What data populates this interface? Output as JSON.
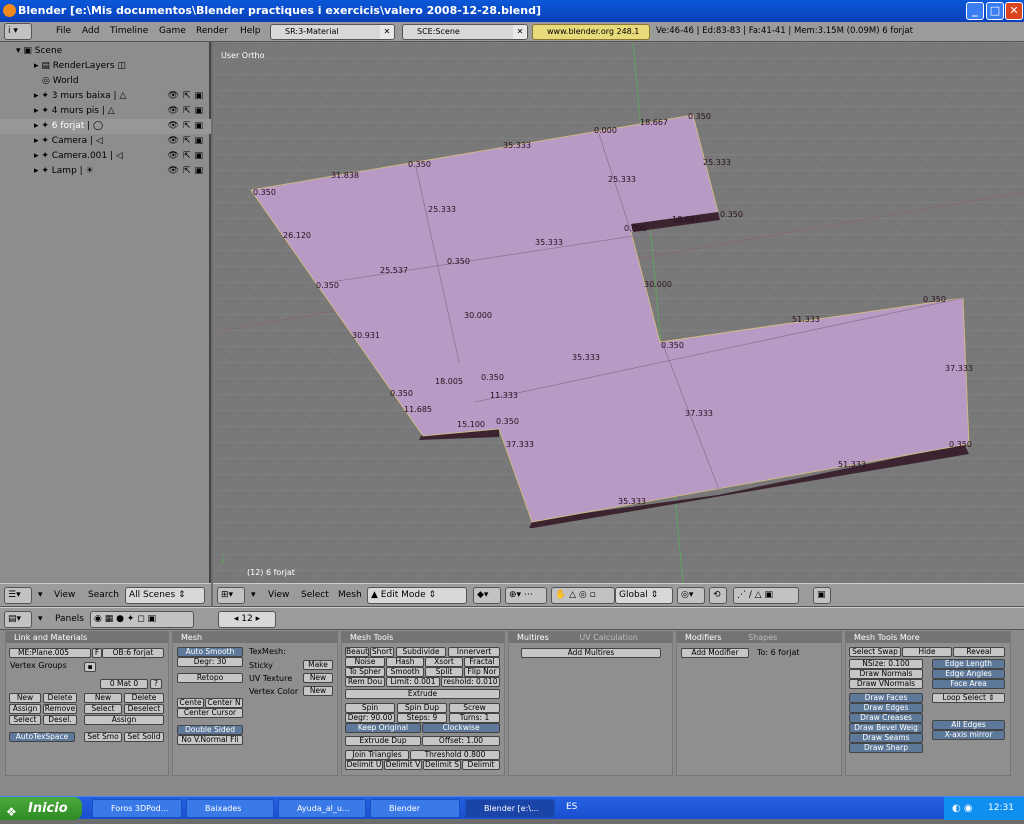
{
  "window": {
    "title": "Blender [e:\\Mis documentos\\Blender practiques i exercicis\\valero 2008-12-28.blend]"
  },
  "topbar": {
    "menus": [
      "File",
      "Add",
      "Timeline",
      "Game",
      "Render",
      "Help"
    ],
    "screen": "SR:3-Material",
    "scene": "SCE:Scene",
    "url": "www.blender.org 248.1",
    "stats": "Ve:46-46 | Ed:83-83 | Fa:41-41 | Mem:3.15M (0.09M) 6 forjat"
  },
  "outliner": {
    "items": [
      {
        "label": "Scene"
      },
      {
        "label": "RenderLayers"
      },
      {
        "label": "World"
      },
      {
        "label": "3 murs baixa"
      },
      {
        "label": "4 murs pis"
      },
      {
        "label": "6 forjat"
      },
      {
        "label": "Camera"
      },
      {
        "label": "Camera.001"
      },
      {
        "label": "Lamp"
      }
    ],
    "header": {
      "view": "View",
      "search": "Search",
      "filter": "All Scenes"
    }
  },
  "viewport": {
    "view_label": "User Ortho",
    "object_label": "(12) 6 forjat",
    "face_color": "#b79bc4",
    "dimensions": [
      {
        "text": "0.350"
      },
      {
        "text": "31.838"
      },
      {
        "text": "0.350"
      },
      {
        "text": "35.333"
      },
      {
        "text": "0.000"
      },
      {
        "text": "18.667"
      },
      {
        "text": "0.350"
      },
      {
        "text": "25.333"
      },
      {
        "text": "25.333"
      },
      {
        "text": "25.333"
      },
      {
        "text": "18.667"
      },
      {
        "text": "0.350"
      },
      {
        "text": "0.000"
      },
      {
        "text": "26.120"
      },
      {
        "text": "35.333"
      },
      {
        "text": "0.350"
      },
      {
        "text": "25.537"
      },
      {
        "text": "0.350"
      },
      {
        "text": "30.000"
      },
      {
        "text": "30.000"
      },
      {
        "text": "0.350"
      },
      {
        "text": "51.333"
      },
      {
        "text": "30.931"
      },
      {
        "text": "0.350"
      },
      {
        "text": "35.333"
      },
      {
        "text": "37.333"
      },
      {
        "text": "18.005"
      },
      {
        "text": "0.350"
      },
      {
        "text": "0.350"
      },
      {
        "text": "11.333"
      },
      {
        "text": "11.685"
      },
      {
        "text": "37.333"
      },
      {
        "text": "15.100"
      },
      {
        "text": "0.350"
      },
      {
        "text": "37.333"
      },
      {
        "text": "0.350"
      },
      {
        "text": "51.333"
      },
      {
        "text": "35.333"
      }
    ]
  },
  "viewheader": {
    "menus": [
      "View",
      "Select",
      "Mesh"
    ],
    "mode": "Edit Mode",
    "orientation": "Global"
  },
  "buttonsheader": {
    "panels": "Panels",
    "frame": "12"
  },
  "panels": {
    "link": {
      "title": "Link and Materials",
      "mesh_name": "ME:Plane.005",
      "f": "F",
      "ob_name": "OB:6 forjat",
      "vertex_groups": "Vertex Groups",
      "mat": "0 Mat 0",
      "q": "?",
      "new1": "New",
      "delete1": "Delete",
      "assign1": "Assign",
      "remove1": "Remove",
      "select1": "Select",
      "desel1": "Desel.",
      "new2": "New",
      "delete2": "Delete",
      "select2": "Select",
      "deselect2": "Deselect",
      "assign2": "Assign",
      "autotex": "AutoTexSpace",
      "setsmo": "Set Smo",
      "setsolid": "Set Solid"
    },
    "mesh": {
      "title": "Mesh",
      "autosmooth": "Auto Smooth",
      "degr": "Degr: 30",
      "retopo": "Retopo",
      "texmesh": "TexMesh:",
      "sticky": "Sticky",
      "make": "Make",
      "uvtex": "UV Texture",
      "new_uv": "New",
      "vcolor": "Vertex Color",
      "new_vc": "New",
      "centre": "Cente",
      "centren": "Center N",
      "centercursor": "Center Cursor",
      "doublesided": "Double Sided",
      "novnormal": "No V.Normal Fli"
    },
    "meshtools": {
      "title": "Mesh Tools",
      "row1": [
        "Beaut",
        "Short",
        "Subdivide",
        "Innervert"
      ],
      "row2": [
        "Noise",
        "Hash",
        "Xsort",
        "Fractal"
      ],
      "row3": [
        "To Spher",
        "Smooth",
        "Split",
        "Flip Nor"
      ],
      "row4": [
        "Rem Dou",
        "Limit: 0.001",
        "reshold: 0.010"
      ],
      "extrude": "Extrude",
      "spin": "Spin",
      "spindup": "Spin Dup",
      "screw": "Screw",
      "degr90": "Degr: 90.00",
      "steps": "Steps: 9",
      "turns": "Turns: 1",
      "keeporig": "Keep Original",
      "clockwise": "Clockwise",
      "extrudedup": "Extrude Dup",
      "offset": "Offset: 1.00",
      "jointri": "Join Triangles",
      "threshold": "Threshold 0.800",
      "delim": [
        "Delimit U",
        "Delimit V",
        "Delimit S",
        "Delimit"
      ]
    },
    "multires": {
      "title": "Multires",
      "tab2": "UV Calculation",
      "add": "Add Multires"
    },
    "modifiers": {
      "title": "Modifiers",
      "tab2": "Shapes",
      "add": "Add Modifier",
      "to": "To: 6 forjat"
    },
    "meshmore": {
      "title": "Mesh Tools More",
      "row1": [
        "Select Swap",
        "Hide",
        "Reveal"
      ],
      "nsize": "NSize: 0.100",
      "drawnormals": "Draw Normals",
      "drawvnormals": "Draw VNormals",
      "edgelength": "Edge Length",
      "edgeangles": "Edge Angles",
      "facearea": "Face Area",
      "drawfaces": "Draw Faces",
      "drawedges": "Draw Edges",
      "drawcreases": "Draw Creases",
      "drawbevel": "Draw Bevel Weig",
      "drawseams": "Draw Seams",
      "drawsharp": "Draw Sharp",
      "loopselect": "Loop Select",
      "alledges": "All Edges",
      "xmirror": "X-axis mirror"
    }
  },
  "taskbar": {
    "start": "Inicio",
    "tasks": [
      "Foros 3DPod...",
      "Baixades",
      "Ayuda_al_u...",
      "Blender",
      "Blender [e:\\..."
    ],
    "lang": "ES",
    "time": "12:31"
  }
}
